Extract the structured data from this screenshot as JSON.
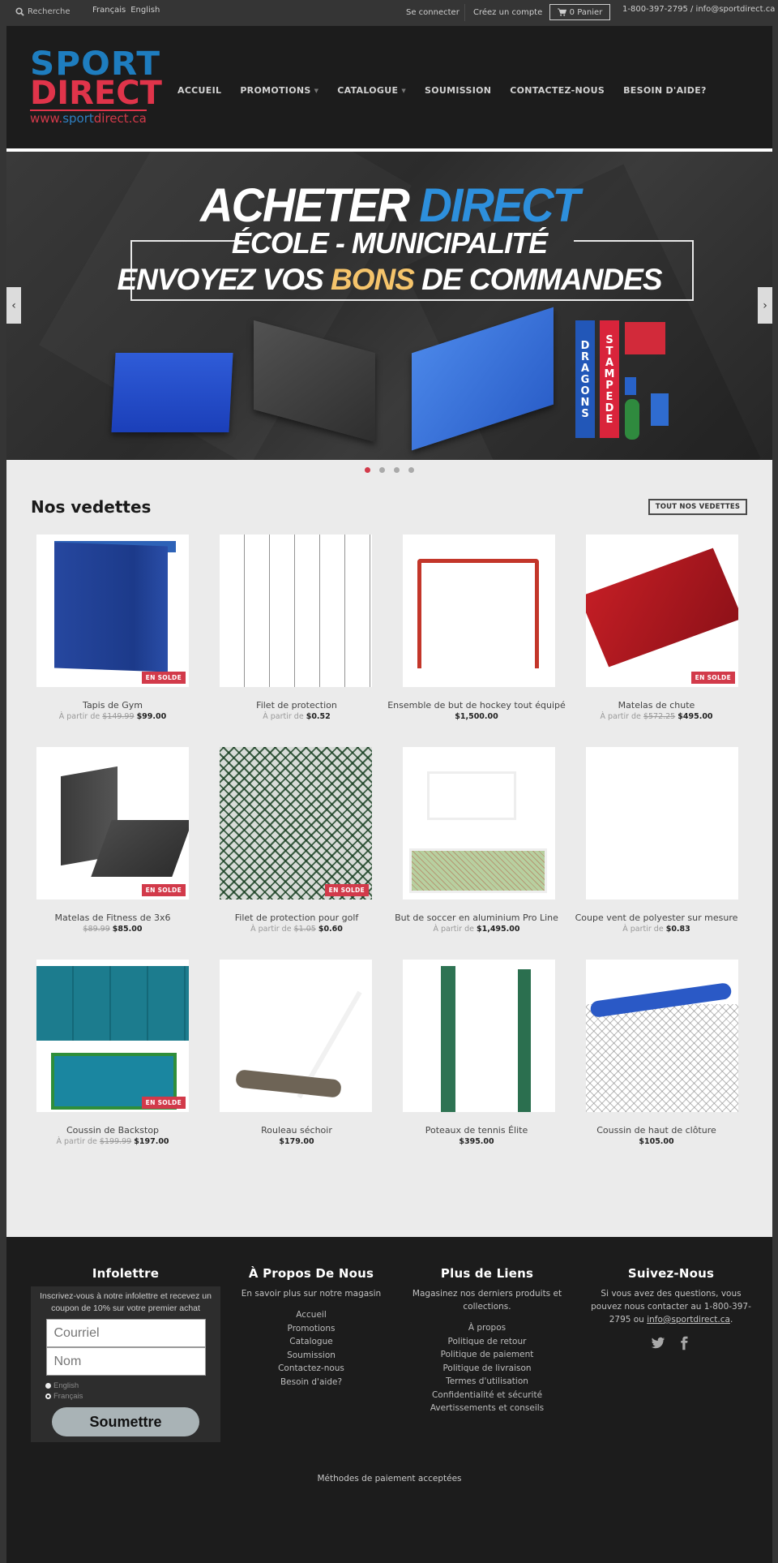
{
  "topbar": {
    "search_label": "Recherche",
    "languages": [
      "Français",
      "English"
    ],
    "login": "Se connecter",
    "register": "Créez un compte",
    "cart": "0 Panier",
    "contact": "1-800-397-2795 / info@sportdirect.ca"
  },
  "logo": {
    "line1": "SPORT",
    "line2": "DIRECT",
    "url_prefix": "www.",
    "url_blue": "sport",
    "url_suffix": "direct.ca"
  },
  "nav": {
    "items": [
      {
        "label": "ACCUEIL",
        "dropdown": false
      },
      {
        "label": "PROMOTIONS",
        "dropdown": true
      },
      {
        "label": "CATALOGUE",
        "dropdown": true
      },
      {
        "label": "SOUMISSION",
        "dropdown": false
      },
      {
        "label": "CONTACTEZ-NOUS",
        "dropdown": false
      },
      {
        "label": "BESOIN D'AIDE?",
        "dropdown": false
      }
    ]
  },
  "hero": {
    "title_white": "ACHETER",
    "title_blue": "DIRECT",
    "subtitle": "ÉCOLE - MUNICIPALITÉ",
    "cta_pre": "ENVOYEZ VOS",
    "cta_highlight": "BONS",
    "cta_post": "DE COMMANDES",
    "pad_blue": "DRAGONS",
    "pad_red": "STAMPEDE",
    "slide_count": 4,
    "active_slide": 1,
    "prev_icon": "chevron-left",
    "next_icon": "chevron-right"
  },
  "featured": {
    "title": "Nos vedettes",
    "all_button": "TOUT NOS VEDETTES",
    "sale_badge": "EN SOLDE",
    "from_label": "À partir de",
    "products": [
      {
        "name": "Tapis de Gym",
        "from": true,
        "old_price": "$149.99",
        "price": "$99.00",
        "on_sale": true
      },
      {
        "name": "Filet de protection",
        "from": true,
        "old_price": "",
        "price": "$0.52",
        "on_sale": false
      },
      {
        "name": "Ensemble de but de hockey tout équipé",
        "from": false,
        "old_price": "",
        "price": "$1,500.00",
        "on_sale": false
      },
      {
        "name": "Matelas de chute",
        "from": true,
        "old_price": "$572.25",
        "price": "$495.00",
        "on_sale": true
      },
      {
        "name": "Matelas de Fitness de 3x6",
        "from": false,
        "old_price": "$89.99",
        "price": "$85.00",
        "on_sale": true
      },
      {
        "name": "Filet de protection pour golf",
        "from": true,
        "old_price": "$1.05",
        "price": "$0.60",
        "on_sale": true
      },
      {
        "name": "But de soccer en aluminium Pro Line",
        "from": true,
        "old_price": "",
        "price": "$1,495.00",
        "on_sale": false
      },
      {
        "name": "Coupe vent de polyester sur mesure",
        "from": true,
        "old_price": "",
        "price": "$0.83",
        "on_sale": false
      },
      {
        "name": "Coussin de Backstop",
        "from": true,
        "old_price": "$199.99",
        "price": "$197.00",
        "on_sale": true
      },
      {
        "name": "Rouleau séchoir",
        "from": false,
        "old_price": "",
        "price": "$179.00",
        "on_sale": false
      },
      {
        "name": "Poteaux de tennis Élite",
        "from": false,
        "old_price": "",
        "price": "$395.00",
        "on_sale": false
      },
      {
        "name": "Coussin de haut de clôture",
        "from": false,
        "old_price": "",
        "price": "$105.00",
        "on_sale": false
      }
    ]
  },
  "footer": {
    "newsletter": {
      "title": "Infolettre",
      "blurb": "Inscrivez-vous à notre infolettre et recevez un coupon de 10% sur votre premier achat",
      "email_placeholder": "Courriel",
      "name_placeholder": "Nom",
      "language_options": [
        "English",
        "Français"
      ],
      "selected_language": "Français",
      "submit": "Soumettre"
    },
    "about": {
      "title": "À Propos De Nous",
      "text": "En savoir plus sur notre magasin",
      "links": [
        "Accueil",
        "Promotions",
        "Catalogue",
        "Soumission",
        "Contactez-nous",
        "Besoin d'aide?"
      ]
    },
    "more_links": {
      "title": "Plus de Liens",
      "text": "Magasinez nos derniers produits et collections.",
      "links": [
        "À propos",
        "Politique de retour",
        "Politique de paiement",
        "Politique de livraison",
        "Termes d'utilisation",
        "Confidentialité et sécurité",
        "Avertissements et conseils"
      ]
    },
    "follow": {
      "title": "Suivez-Nous",
      "text_pre": "Si vous avez des questions, vous pouvez nous contacter au 1-800-397-2795 ou ",
      "email": "info@sportdirect.ca",
      "text_post": ".",
      "social": [
        "twitter",
        "facebook"
      ]
    },
    "payments_label": "Méthodes de paiement acceptées"
  }
}
